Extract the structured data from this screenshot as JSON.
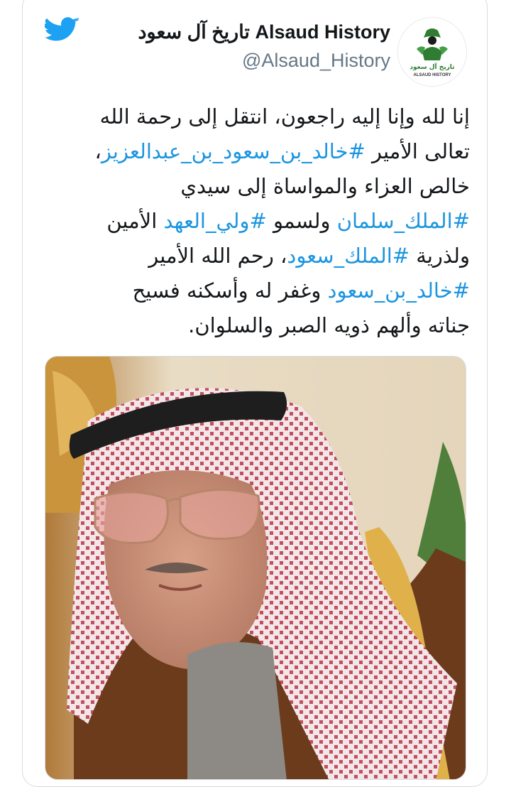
{
  "tweet": {
    "account_name": "تاريخ آل سعود Alsaud History",
    "handle": "@Alsaud_History",
    "avatar_caption_ar": "تاريخ آل سعود",
    "avatar_caption_en": "ALSAUD HISTORY",
    "lines": [
      [
        {
          "t": "إنا لله وإنا إليه راجعون، انتقل إلى رحمة الله",
          "h": false
        }
      ],
      [
        {
          "t": "تعالى الأمير ",
          "h": false
        },
        {
          "t": "#خالد_بن_سعود_بن_عبدالعزيز",
          "h": true
        },
        {
          "t": "،",
          "h": false
        }
      ],
      [
        {
          "t": "خالص العزاء والمواساة إلى سيدي",
          "h": false
        }
      ],
      [
        {
          "t": "#الملك_سلمان",
          "h": true
        },
        {
          "t": " ولسمو ",
          "h": false
        },
        {
          "t": "#ولي_العهد",
          "h": true
        },
        {
          "t": " الأمين",
          "h": false
        }
      ],
      [
        {
          "t": "ولذرية ",
          "h": false
        },
        {
          "t": "#الملك_سعود",
          "h": true
        },
        {
          "t": "، رحم الله الأمير",
          "h": false
        }
      ],
      [
        {
          "t": "#خالد_بن_سعود",
          "h": true
        },
        {
          "t": " وغفر له وأسكنه فسيح",
          "h": false
        }
      ],
      [
        {
          "t": "جناته وألهم ذويه الصبر والسلوان.",
          "h": false
        }
      ]
    ]
  },
  "icons": {
    "brand": "twitter-bird-icon",
    "avatar": "alsaud-history-logo"
  },
  "colors": {
    "twitter_blue": "#1da1f2",
    "hashtag": "#1b95e0",
    "text": "#14171a",
    "secondary": "#657786",
    "logo_green": "#2e7d32"
  }
}
